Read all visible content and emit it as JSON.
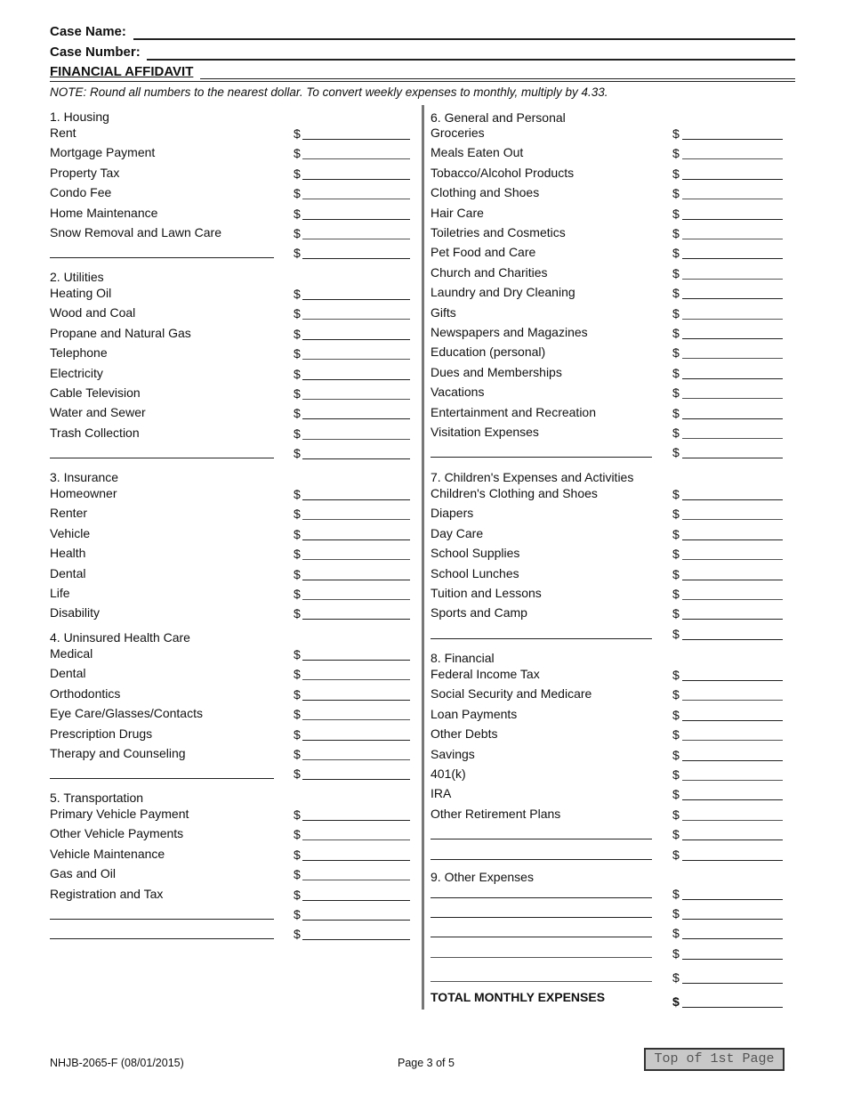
{
  "header": {
    "case_name_label": "Case Name:",
    "case_name_value": "",
    "case_number_label": "Case Number:",
    "case_number_value": "",
    "title": "FINANCIAL AFFIDAVIT",
    "note": "NOTE:  Round all numbers to the nearest dollar.  To convert weekly expenses to monthly, multiply by 4.33."
  },
  "currency_symbol": "$",
  "left_column": {
    "housing": {
      "heading": "1. Housing",
      "items": [
        "Rent",
        "Mortgage Payment",
        "Property Tax",
        "Condo Fee",
        "Home Maintenance",
        "Snow Removal and Lawn Care"
      ]
    },
    "utilities": {
      "heading": "2. Utilities",
      "items": [
        "Heating Oil",
        "Wood and Coal",
        "Propane and Natural Gas",
        "Telephone",
        "Electricity",
        "Cable Television",
        "Water and Sewer",
        "Trash Collection"
      ]
    },
    "insurance": {
      "heading": "3. Insurance",
      "items": [
        "Homeowner",
        "Renter",
        "Vehicle",
        "Health",
        "Dental",
        "Life",
        "Disability"
      ]
    },
    "uninsured": {
      "heading": "4. Uninsured Health Care",
      "items": [
        "Medical",
        "Dental",
        "Orthodontics",
        "Eye Care/Glasses/Contacts",
        "Prescription Drugs",
        "Therapy and Counseling"
      ]
    },
    "transportation": {
      "heading": "5. Transportation",
      "items": [
        "Primary Vehicle Payment",
        "Other Vehicle Payments",
        "Vehicle Maintenance",
        "Gas and Oil",
        "Registration and Tax"
      ]
    }
  },
  "right_column": {
    "general": {
      "heading": "6. General and Personal",
      "items": [
        "Groceries",
        "Meals Eaten Out",
        "Tobacco/Alcohol Products",
        "Clothing and Shoes",
        "Hair Care",
        "Toiletries and Cosmetics",
        "Pet Food and Care",
        "Church and Charities",
        "Laundry and Dry Cleaning",
        "Gifts",
        "Newspapers and Magazines",
        "Education (personal)",
        "Dues and Memberships",
        "Vacations",
        "Entertainment and Recreation",
        "Visitation Expenses"
      ]
    },
    "children": {
      "heading": "7. Children's Expenses and Activities",
      "items": [
        "Children's Clothing and Shoes",
        "Diapers",
        "Day Care",
        "School Supplies",
        "School Lunches",
        "Tuition and Lessons",
        "Sports and Camp"
      ]
    },
    "financial": {
      "heading": "8. Financial",
      "items": [
        "Federal Income Tax",
        "Social Security and Medicare",
        "Loan Payments",
        "Other Debts",
        "Savings",
        "401(k)",
        "IRA",
        "Other Retirement Plans"
      ]
    },
    "other": {
      "heading": "9. Other Expenses"
    },
    "total_label": "TOTAL MONTHLY EXPENSES"
  },
  "footer": {
    "form_id": "NHJB-2065-F (08/01/2015)",
    "page": "Page 3 of 5",
    "top_button": "Top of 1st Page"
  }
}
